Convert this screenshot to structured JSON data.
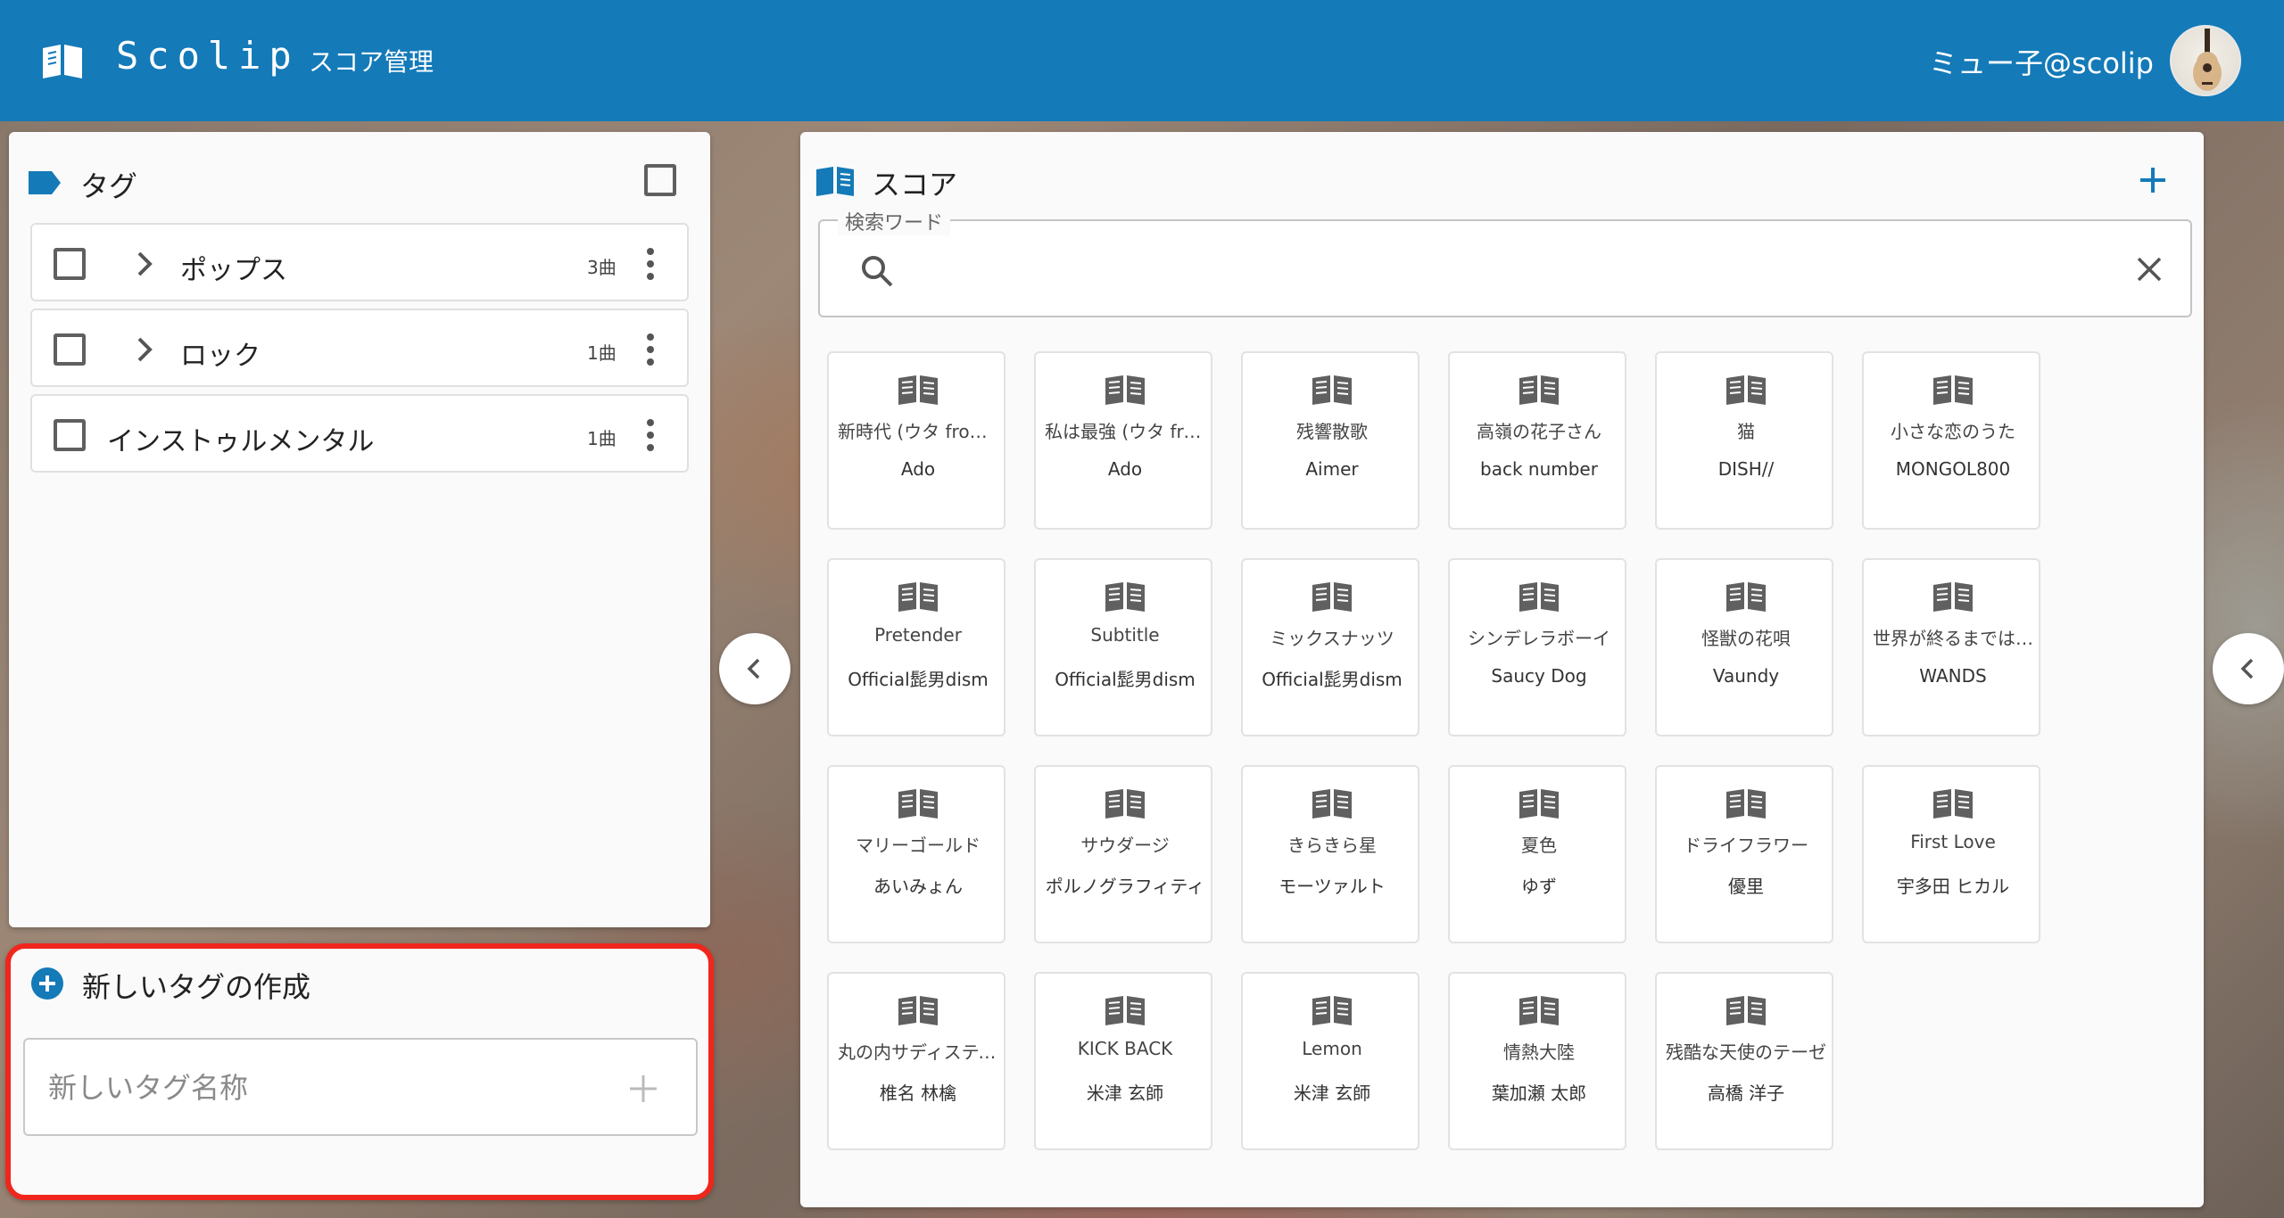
{
  "header": {
    "app_title": "Scolip",
    "nav_link": "スコア管理",
    "user_name": "ミュー子@scolip",
    "brand_color": "#147ab8"
  },
  "tags_panel": {
    "title": "タグ",
    "items": [
      {
        "name": "ポップス",
        "count": "3曲",
        "expandable": true
      },
      {
        "name": "ロック",
        "count": "1曲",
        "expandable": true
      },
      {
        "name": "インストゥルメンタル",
        "count": "1曲",
        "expandable": false
      }
    ]
  },
  "new_tag": {
    "title": "新しいタグの作成",
    "placeholder": "新しいタグ名称",
    "highlight_color": "#f0261c"
  },
  "score_panel": {
    "title": "スコア",
    "search_legend": "検索ワード",
    "scores": [
      {
        "song": "新時代 (ウタ from ONE PIECE FILM RED)",
        "artist": "Ado"
      },
      {
        "song": "私は最強 (ウタ from ONE PIECE FILM RED)",
        "artist": "Ado"
      },
      {
        "song": "残響散歌",
        "artist": "Aimer"
      },
      {
        "song": "高嶺の花子さん",
        "artist": "back number"
      },
      {
        "song": "猫",
        "artist": "DISH//"
      },
      {
        "song": "小さな恋のうた",
        "artist": "MONGOL800"
      },
      {
        "song": "Pretender",
        "artist": "Official髭男dism"
      },
      {
        "song": "Subtitle",
        "artist": "Official髭男dism"
      },
      {
        "song": "ミックスナッツ",
        "artist": "Official髭男dism"
      },
      {
        "song": "シンデレラボーイ",
        "artist": "Saucy Dog"
      },
      {
        "song": "怪獣の花唄",
        "artist": "Vaundy"
      },
      {
        "song": "世界が終るまでは…",
        "artist": "WANDS"
      },
      {
        "song": "マリーゴールド",
        "artist": "あいみょん"
      },
      {
        "song": "サウダージ",
        "artist": "ポルノグラフィティ"
      },
      {
        "song": "きらきら星",
        "artist": "モーツァルト"
      },
      {
        "song": "夏色",
        "artist": "ゆず"
      },
      {
        "song": "ドライフラワー",
        "artist": "優里"
      },
      {
        "song": "First Love",
        "artist": "宇多田 ヒカル"
      },
      {
        "song": "丸の内サディスティック",
        "artist": "椎名 林檎"
      },
      {
        "song": "KICK BACK",
        "artist": "米津 玄師"
      },
      {
        "song": "Lemon",
        "artist": "米津 玄師"
      },
      {
        "song": "情熱大陸",
        "artist": "葉加瀬 太郎"
      },
      {
        "song": "残酷な天使のテーゼ",
        "artist": "高橋 洋子"
      }
    ]
  }
}
